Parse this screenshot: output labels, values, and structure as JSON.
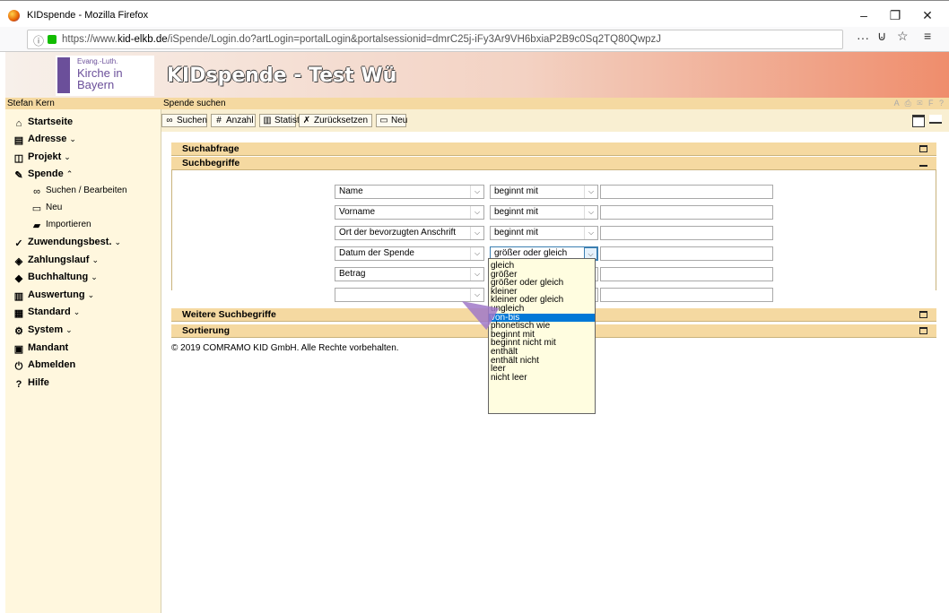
{
  "window": {
    "title": "KIDspende - Mozilla Firefox",
    "min": "–",
    "max": "❐",
    "close": "✕"
  },
  "browser": {
    "url_prefix": "https://www.",
    "url_domain": "kid-elkb.de",
    "url_rest": "/iSpende/Login.do?artLogin=portalLogin&portalsessionid=dmrC25j-iFy3Ar9VH6bxiaP2B9c0Sq2TQ80QwpzJ",
    "more": "···",
    "pocket": "⊍",
    "bookmark": "☆",
    "menu": "≡"
  },
  "header": {
    "logo_line1": "Evang.-Luth.",
    "logo_line2": "Kirche in",
    "logo_line3": "Bayern",
    "app_title": "KIDspende - Test Wü"
  },
  "sidebar": {
    "user": "Stefan Kern",
    "items": [
      {
        "label": "Startseite",
        "icon": "home-icon",
        "glyph": "⌂",
        "caret": ""
      },
      {
        "label": "Adresse",
        "icon": "address-icon",
        "glyph": "▤",
        "caret": "⌄"
      },
      {
        "label": "Projekt",
        "icon": "project-icon",
        "glyph": "◫",
        "caret": "⌄"
      },
      {
        "label": "Spende",
        "icon": "donation-icon",
        "glyph": "✎",
        "caret": "⌃"
      },
      {
        "label": "Suchen / Bearbeiten",
        "icon": "binoculars-icon",
        "glyph": "∞",
        "caret": ""
      },
      {
        "label": "Neu",
        "icon": "new-document-icon",
        "glyph": "▭",
        "caret": ""
      },
      {
        "label": "Importieren",
        "icon": "import-icon",
        "glyph": "▰",
        "caret": ""
      },
      {
        "label": "Zuwendungsbest.",
        "icon": "receipt-icon",
        "glyph": "✓",
        "caret": "⌄"
      },
      {
        "label": "Zahlungslauf",
        "icon": "payment-icon",
        "glyph": "◈",
        "caret": "⌄"
      },
      {
        "label": "Buchhaltung",
        "icon": "accounting-icon",
        "glyph": "◆",
        "caret": "⌄"
      },
      {
        "label": "Auswertung",
        "icon": "chart-icon",
        "glyph": "▥",
        "caret": "⌄"
      },
      {
        "label": "Standard",
        "icon": "standard-icon",
        "glyph": "▦",
        "caret": "⌄"
      },
      {
        "label": "System",
        "icon": "system-gear-icon",
        "glyph": "⚙",
        "caret": "⌄"
      },
      {
        "label": "Mandant",
        "icon": "client-icon",
        "glyph": "▣",
        "caret": ""
      },
      {
        "label": "Abmelden",
        "icon": "logout-icon",
        "glyph": "⏻",
        "caret": ""
      },
      {
        "label": "Hilfe",
        "icon": "help-icon",
        "glyph": "?",
        "caret": ""
      }
    ]
  },
  "main": {
    "breadcrumb": "Spende suchen",
    "tools": "A ⎙ ✉ F ?",
    "toolbar": [
      {
        "label": "Suchen",
        "icon": "binoculars-icon",
        "glyph": "∞"
      },
      {
        "label": "Anzahl",
        "icon": "count-icon",
        "glyph": "#"
      },
      {
        "label": "Statistik",
        "icon": "statistics-icon",
        "glyph": "▥"
      },
      {
        "label": "Zurücksetzen",
        "icon": "reset-icon",
        "glyph": "✗"
      },
      {
        "label": "Neu",
        "icon": "new-document-icon",
        "glyph": "▭"
      }
    ],
    "sections": {
      "query": "Suchabfrage",
      "terms": "Suchbegriffe",
      "more_terms": "Weitere Suchbegriffe",
      "sort": "Sortierung"
    },
    "rows": [
      {
        "field": "Name",
        "op": "beginnt mit"
      },
      {
        "field": "Vorname",
        "op": "beginnt mit"
      },
      {
        "field": "Ort der bevorzugten Anschrift",
        "op": "beginnt mit"
      },
      {
        "field": "Datum der Spende",
        "op": "größer oder gleich"
      },
      {
        "field": "Betrag",
        "op": ""
      },
      {
        "field": "",
        "op": ""
      }
    ],
    "dropdown_options": [
      "gleich",
      "größer",
      "größer oder gleich",
      "kleiner",
      "kleiner oder gleich",
      "ungleich",
      "von-bis",
      "phonetisch wie",
      "beginnt mit",
      "beginnt nicht mit",
      "enthält",
      "enthält nicht",
      "leer",
      "nicht leer"
    ],
    "dropdown_selected": "von-bis",
    "copyright": "© 2019 COMRAMO KID GmbH. Alle Rechte vorbehalten."
  }
}
